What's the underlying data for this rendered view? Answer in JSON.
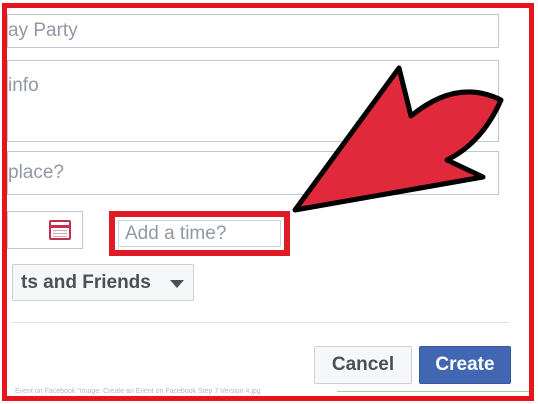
{
  "form": {
    "event_name_value": "ay Party",
    "details_placeholder": " info",
    "where_placeholder": "place?",
    "time_placeholder": "Add a time?",
    "privacy_label": "ts and Friends"
  },
  "footer": {
    "cancel_label": "Cancel",
    "create_label": "Create"
  },
  "caption": "Event on Facebook \"Image: Create an Event on Facebook Step 7 Version 4.jpg",
  "colors": {
    "frame_border": "#e8141c",
    "arrow_fill": "#e02a3c",
    "create_button": "#4267b2"
  },
  "icons": [
    "calendar-icon",
    "chevron-down-icon",
    "pointer-arrow"
  ]
}
